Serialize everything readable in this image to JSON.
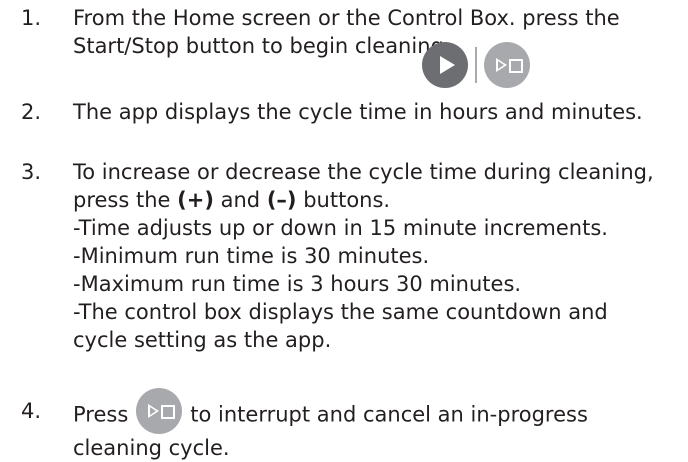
{
  "steps": [
    {
      "number": "1.",
      "lines": [
        "From the Home screen or the Control Box. press the",
        "Start/Stop button to begin cleaning."
      ],
      "icons": [
        "play-icon",
        "start-stop-icon"
      ]
    },
    {
      "number": "2.",
      "lines": [
        "The app displays the cycle time in hours and minutes."
      ]
    },
    {
      "number": "3.",
      "lines": [
        "To increase or decrease the cycle time during cleaning,",
        "press the",
        "(+)",
        "and",
        "(–)",
        "buttons.",
        "-Time adjusts up or down in 15 minute increments.",
        "-Minimum run time is 30 minutes.",
        "-Maximum run time is 3 hours 30 minutes.",
        "-The control box displays the same countdown and",
        "cycle setting as the app."
      ]
    },
    {
      "number": "4.",
      "lines": [
        "Press",
        "to interrupt and cancel an in-progress",
        "cleaning cycle."
      ],
      "icons": [
        "start-stop-icon"
      ]
    }
  ],
  "colors": {
    "text": "#231f20",
    "play_button": "#6d6e71",
    "start_stop_button": "#a7a9ac"
  }
}
